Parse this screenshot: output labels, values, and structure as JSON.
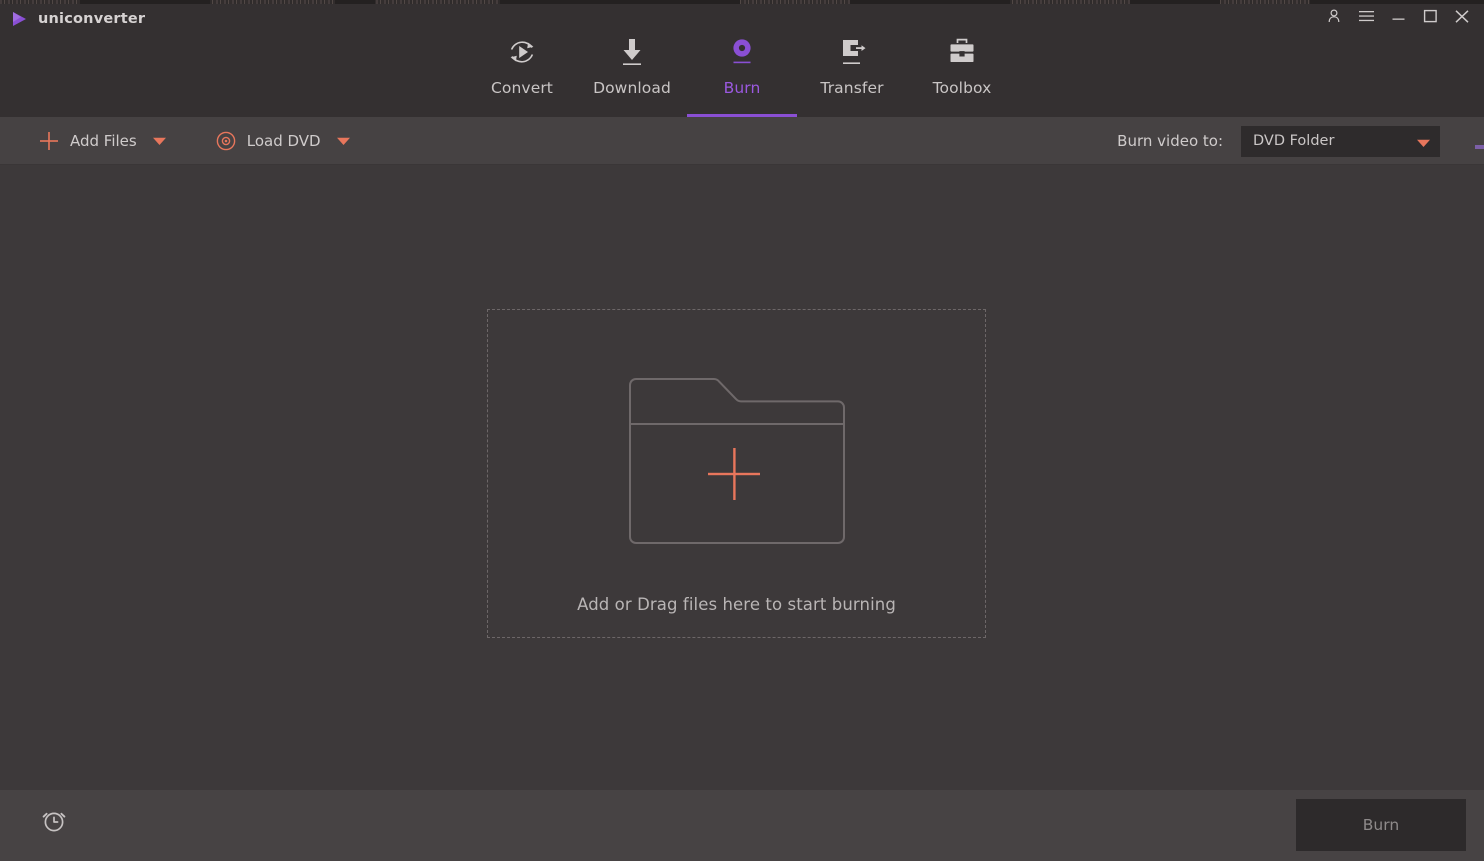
{
  "app": {
    "title": "uniconverter",
    "logo_icon": "play-triangle-logo"
  },
  "window_controls": [
    {
      "name": "account-button",
      "icon": "person-icon"
    },
    {
      "name": "menu-button",
      "icon": "hamburger-menu-icon"
    },
    {
      "name": "minimize-button",
      "icon": "minimize-icon"
    },
    {
      "name": "maximize-button",
      "icon": "maximize-icon"
    },
    {
      "name": "close-button",
      "icon": "close-icon"
    }
  ],
  "nav": {
    "active": "Burn",
    "tabs": [
      {
        "label": "Convert",
        "icon": "convert-refresh-play-icon",
        "active": false
      },
      {
        "label": "Download",
        "icon": "download-arrow-icon",
        "active": false
      },
      {
        "label": "Burn",
        "icon": "burn-disc-icon",
        "active": true
      },
      {
        "label": "Transfer",
        "icon": "transfer-arrow-icon",
        "active": false
      },
      {
        "label": "Toolbox",
        "icon": "toolbox-icon",
        "active": false
      }
    ]
  },
  "toolbar": {
    "add_files": {
      "label": "Add Files",
      "icon": "plus-icon",
      "caret": "chevron-down-icon"
    },
    "load_dvd": {
      "label": "Load DVD",
      "icon": "dvd-disc-icon",
      "caret": "chevron-down-icon"
    },
    "burn_video_to_label": "Burn video to:",
    "output_select": {
      "value": "DVD Folder",
      "caret": "chevron-down-icon",
      "options": [
        "DVD Folder"
      ]
    }
  },
  "dropzone": {
    "text": "Add or Drag files here to start burning",
    "folder_icon": "folder-icon",
    "plus_icon": "plus-icon"
  },
  "footer": {
    "timer_icon": "alarm-clock-icon",
    "burn_button_label": "Burn"
  },
  "colors": {
    "accent_purple": "#8a4fd4",
    "accent_purple_text": "#9b59e0",
    "accent_coral": "#e8765c",
    "header_bg": "#343031",
    "toolbar_bg": "#464243",
    "content_bg": "#3d393a",
    "footer_bg": "#474344",
    "select_bg": "#2e2b2c",
    "burn_button_bg": "#2d2a2b",
    "text_primary": "#cfcbcb",
    "text_muted": "#8e8a8a"
  }
}
